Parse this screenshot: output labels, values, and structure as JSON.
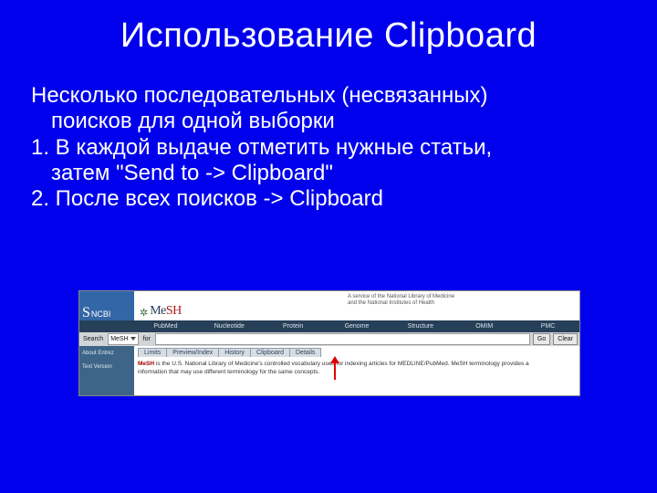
{
  "title": "Использование Clipboard",
  "body": {
    "intro_l1": "Несколько последовательных (несвязанных)",
    "intro_l2": "поисков для одной выборки",
    "step1_l1": "1. В каждой выдаче отметить нужные статьи,",
    "step1_l2": "затем \"Send to -> Clipboard\"",
    "step2": "2. После всех  поисков -> Clipboard"
  },
  "shot": {
    "ncbi": "NCBI",
    "mesh_prefix": "Me",
    "mesh_suffix": "SH",
    "banner_line1": "A service of the National Library of Medicine",
    "banner_line2": "and the National Institutes of Health",
    "nav": [
      "PubMed",
      "Nucleotide",
      "Protein",
      "Genome",
      "Structure",
      "OMIM",
      "PMC"
    ],
    "search_label": "Search",
    "search_db": "MeSH",
    "search_for": "for",
    "btn_go": "Go",
    "btn_clear": "Clear",
    "side": [
      "About Entrez",
      "Text Version"
    ],
    "tabs": [
      "Limits",
      "Preview/Index",
      "History",
      "Clipboard",
      "Details"
    ],
    "desc_term": "MeSH",
    "desc_rest1": " is the U.S. National Library of Medicine's controlled vocabulary used for indexing articles for MEDLINE/PubMed. MeSH terminology provides a",
    "desc_rest2": "information that may use different terminology for the same concepts."
  }
}
